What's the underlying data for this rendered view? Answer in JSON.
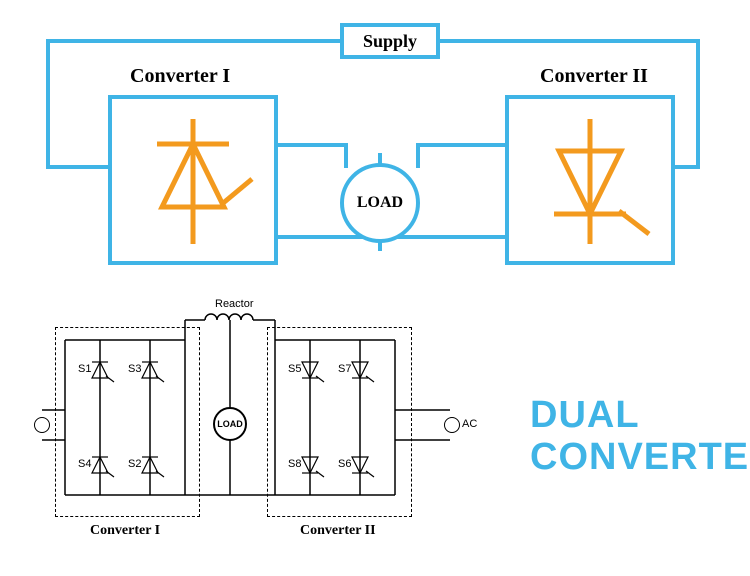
{
  "top": {
    "supply": "Supply",
    "converter1": "Converter I",
    "converter2": "Converter II",
    "load": "LOAD"
  },
  "bottom": {
    "reactor": "Reactor",
    "converter1": "Converter I",
    "converter2": "Converter II",
    "load": "LOAD",
    "ac": "AC",
    "switches": {
      "s1": "S1",
      "s2": "S2",
      "s3": "S3",
      "s4": "S4",
      "s5": "S5",
      "s6": "S6",
      "s7": "S7",
      "s8": "S8"
    }
  },
  "title": {
    "line1": "DUAL",
    "line2": "CONVERTER"
  }
}
